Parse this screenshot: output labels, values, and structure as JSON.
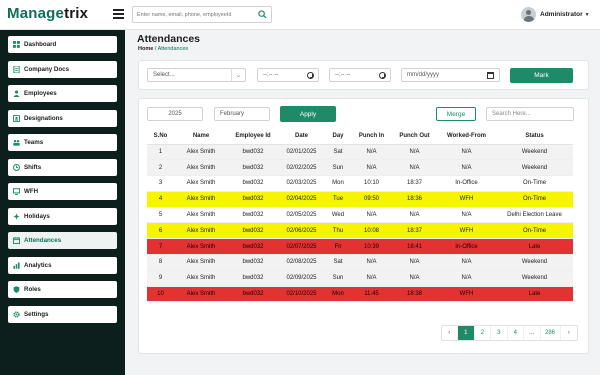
{
  "app": {
    "logo_pre": "Manage",
    "logo_x": "trix"
  },
  "topbar": {
    "search_placeholder": "Enter name, email, phone, employeeId",
    "user_name": "Administrator"
  },
  "sidebar": {
    "items": [
      {
        "label": "Dashboard",
        "icon": "dashboard-icon"
      },
      {
        "label": "Company Docs",
        "icon": "docs-icon"
      },
      {
        "label": "Employees",
        "icon": "employees-icon"
      },
      {
        "label": "Designations",
        "icon": "designation-icon"
      },
      {
        "label": "Teams",
        "icon": "teams-icon"
      },
      {
        "label": "Shifts",
        "icon": "shifts-icon"
      },
      {
        "label": "WFH",
        "icon": "wfh-icon"
      },
      {
        "label": "Holidays",
        "icon": "holidays-icon"
      },
      {
        "label": "Attendances",
        "icon": "attendance-icon",
        "active": true
      },
      {
        "label": "Analytics",
        "icon": "analytics-icon"
      },
      {
        "label": "Roles",
        "icon": "roles-icon"
      },
      {
        "label": "Settings",
        "icon": "settings-icon"
      }
    ]
  },
  "page": {
    "title": "Attendances",
    "breadcrumb_home": "Home",
    "breadcrumb_sep": "/",
    "breadcrumb_current": "Attendances"
  },
  "filters": {
    "select_placeholder": "Select...",
    "time_from": "--:-- --",
    "time_to": "--:-- --",
    "date_placeholder": "mm/dd/yyyy",
    "mark_label": "Mark"
  },
  "list": {
    "year": "2025",
    "month": "February",
    "apply_label": "Apply",
    "merge_label": "Merge",
    "search_placeholder": "Search Here...",
    "columns": [
      "S.No",
      "Name",
      "Employee Id",
      "Date",
      "Day",
      "Punch In",
      "Punch Out",
      "Worked-From",
      "Status"
    ],
    "rows": [
      {
        "type": "weekend",
        "cells": [
          "1",
          "Alex Smith",
          "bwd032",
          "02/01/2025",
          "Sat",
          "N/A",
          "N/A",
          "N/A",
          "Weekend"
        ]
      },
      {
        "type": "weekend",
        "cells": [
          "2",
          "Alex Smith",
          "bwd032",
          "02/02/2025",
          "Sun",
          "N/A",
          "N/A",
          "N/A",
          "Weekend"
        ]
      },
      {
        "type": "normal",
        "cells": [
          "3",
          "Alex Smith",
          "bwd032",
          "02/03/2025",
          "Mon",
          "10:10",
          "18:37",
          "In-Office",
          "On-Time"
        ]
      },
      {
        "type": "wfh",
        "cells": [
          "4",
          "Alex Smith",
          "bwd032",
          "02/04/2025",
          "Tue",
          "09:50",
          "18:36",
          "WFH",
          "On-Time"
        ]
      },
      {
        "type": "normal",
        "cells": [
          "5",
          "Alex Smith",
          "bwd032",
          "02/05/2025",
          "Wed",
          "N/A",
          "N/A",
          "N/A",
          "Delhi Election Leave"
        ]
      },
      {
        "type": "wfh",
        "cells": [
          "6",
          "Alex Smith",
          "bwd032",
          "02/06/2025",
          "Thu",
          "10:08",
          "18:37",
          "WFH",
          "On-Time"
        ]
      },
      {
        "type": "late",
        "cells": [
          "7",
          "Alex Smith",
          "bwd032",
          "02/07/2025",
          "Fri",
          "10:39",
          "18:41",
          "In-Office",
          "Late"
        ]
      },
      {
        "type": "weekend",
        "cells": [
          "8",
          "Alex Smith",
          "bwd032",
          "02/08/2025",
          "Sat",
          "N/A",
          "N/A",
          "N/A",
          "Weekend"
        ]
      },
      {
        "type": "weekend",
        "cells": [
          "9",
          "Alex Smith",
          "bwd032",
          "02/09/2025",
          "Sun",
          "N/A",
          "N/A",
          "N/A",
          "Weekend"
        ]
      },
      {
        "type": "late",
        "cells": [
          "10",
          "Alex Smith",
          "bwd032",
          "02/10/2025",
          "Mon",
          "11:45",
          "18:38",
          "WFH",
          "Late"
        ]
      }
    ]
  },
  "pagination": {
    "prev": "‹",
    "pages": [
      "1",
      "2",
      "3",
      "4",
      "...",
      "286"
    ],
    "active_page": "1",
    "next": "›"
  },
  "colors": {
    "brand": "#0f6e58",
    "button": "#1e8a68",
    "sidebar_bg": "#0d1f1c",
    "wfh_row": "#f6f400",
    "late_row": "#e43232",
    "weekend_row": "#f2f2f2"
  }
}
